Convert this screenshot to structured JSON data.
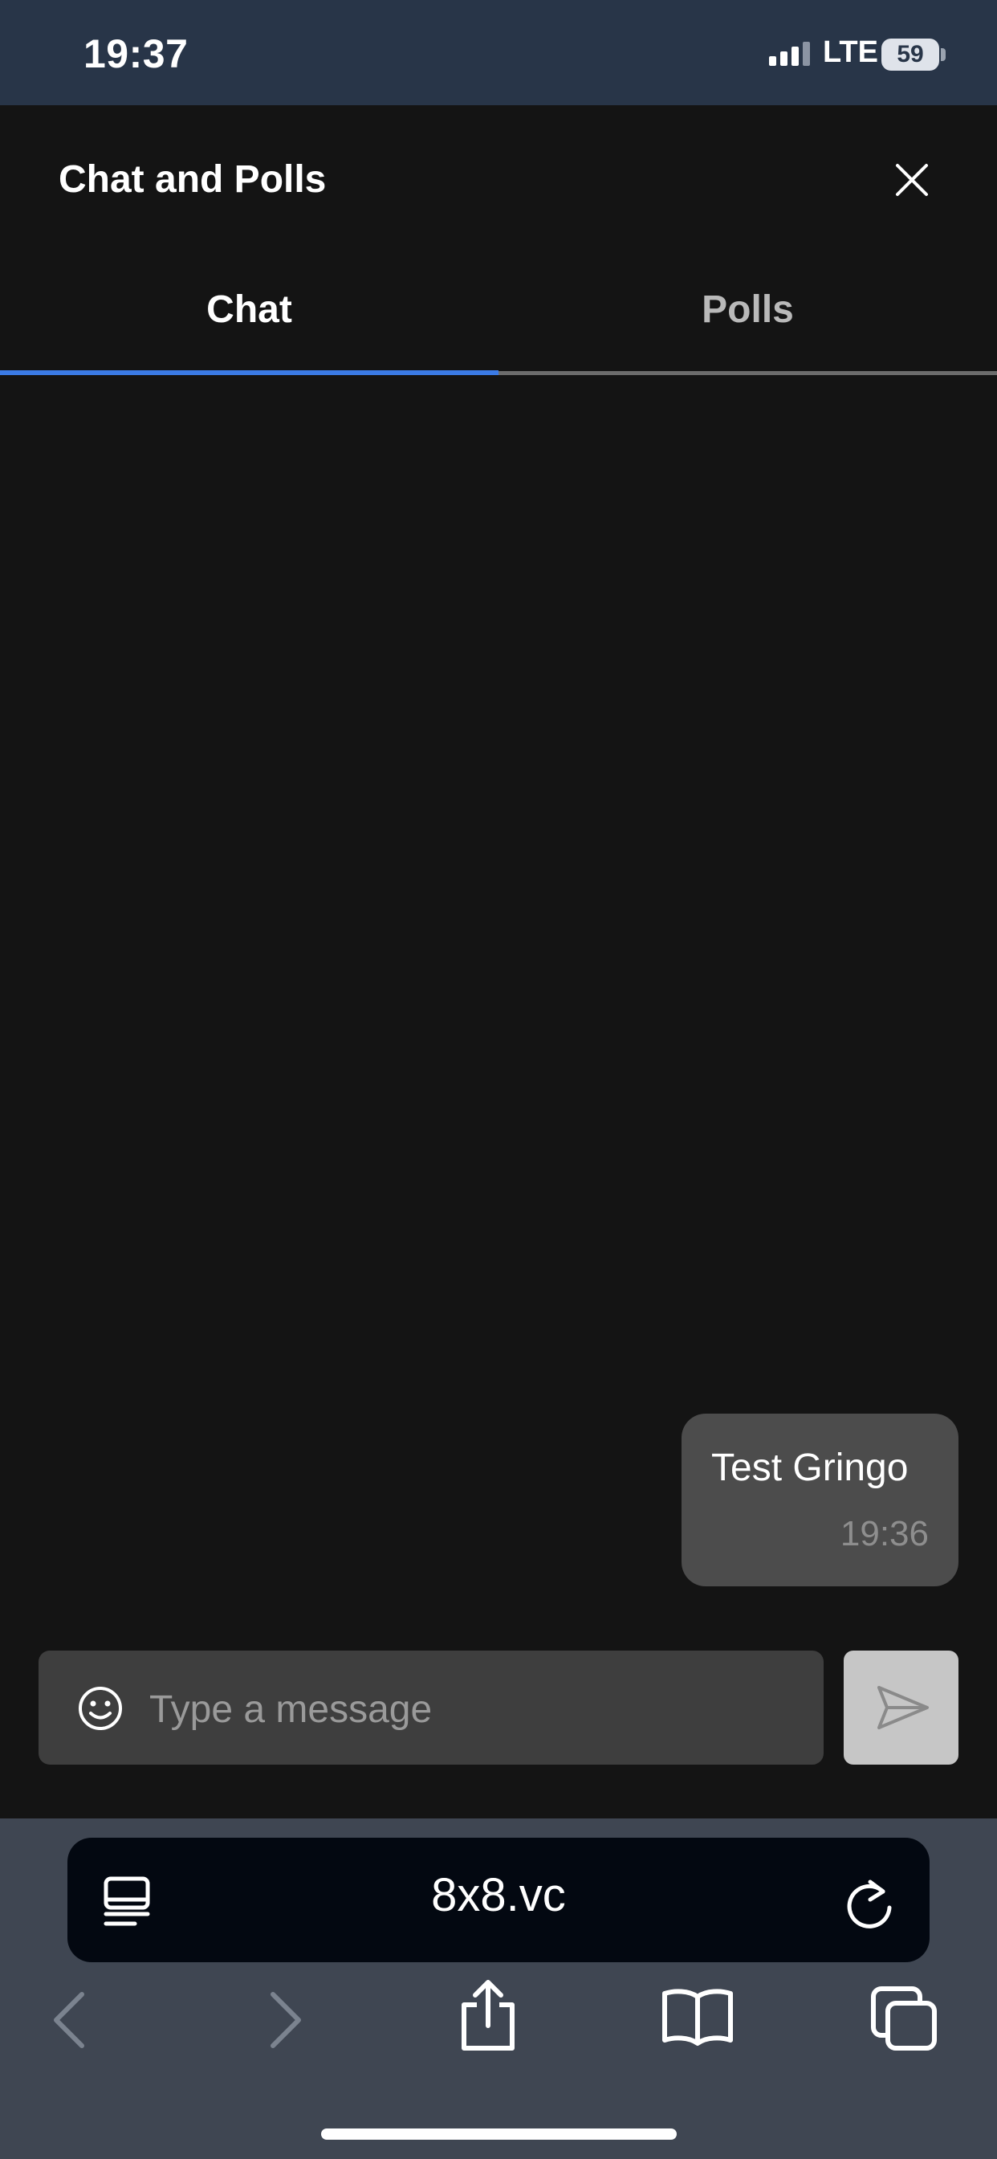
{
  "status_bar": {
    "time": "19:37",
    "network": "LTE",
    "battery": "59"
  },
  "header": {
    "title": "Chat and Polls",
    "close_icon": "close-icon"
  },
  "tabs": [
    {
      "label": "Chat",
      "active": true
    },
    {
      "label": "Polls",
      "active": false
    }
  ],
  "messages": [
    {
      "text": "Test Gringo",
      "time": "19:36"
    }
  ],
  "composer": {
    "placeholder": "Type a message",
    "emoji_icon": "smiley-icon",
    "send_icon": "send-icon"
  },
  "browser": {
    "url": "8x8.vc",
    "icons": [
      "reader-icon",
      "reload-icon",
      "back-icon",
      "forward-icon",
      "share-icon",
      "bookmarks-icon",
      "tabs-icon"
    ]
  },
  "colors": {
    "accent": "#3b7be6",
    "status_bar_bg": "#283548",
    "panel_bg": "#141414",
    "bubble_bg": "#4c4c4c",
    "browser_bg": "#3f4652"
  }
}
